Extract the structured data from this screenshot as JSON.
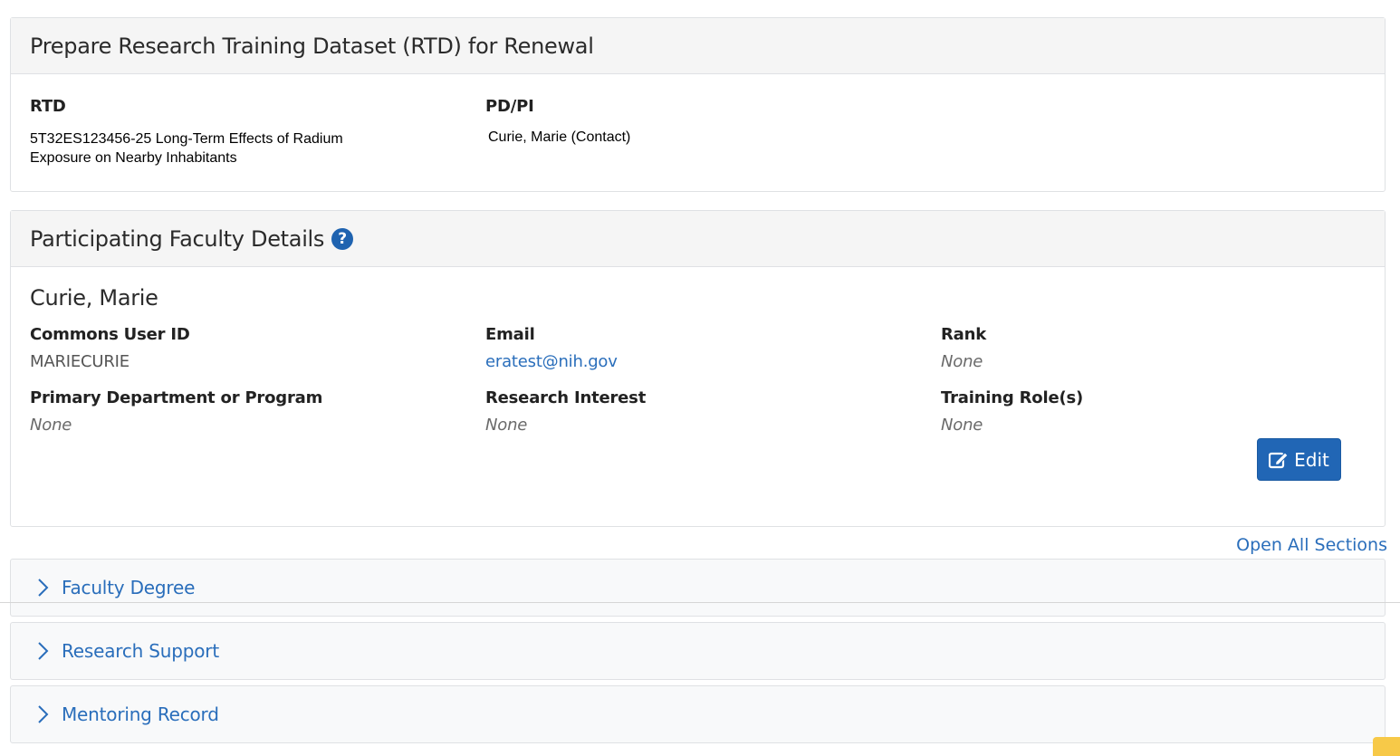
{
  "rtd_panel": {
    "title": "Prepare Research Training Dataset (RTD) for Renewal",
    "rtd_label": "RTD",
    "rtd_value_line1": "5T32ES123456-25 Long-Term Effects of Radium",
    "rtd_value_line2": "Exposure on Nearby Inhabitants",
    "pdpi_label": "PD/PI",
    "pdpi_value": "Curie, Marie (Contact)"
  },
  "faculty_panel": {
    "title": "Participating Faculty Details",
    "help_icon": "question-circle-icon",
    "name": "Curie, Marie",
    "fields": {
      "commons_label": "Commons User ID",
      "commons_value": "MARIECURIE",
      "email_label": "Email",
      "email_value": "eratest@nih.gov",
      "rank_label": "Rank",
      "rank_value": "None",
      "dept_label": "Primary Department or Program",
      "dept_value": "None",
      "interest_label": "Research Interest",
      "interest_value": "None",
      "roles_label": "Training Role(s)",
      "roles_value": "None"
    },
    "edit_label": "Edit",
    "edit_icon": "edit-icon"
  },
  "open_all_label": "Open All Sections",
  "sections": [
    {
      "label": "Faculty Degree",
      "icon": "chevron-right-icon"
    },
    {
      "label": "Research Support",
      "icon": "chevron-right-icon"
    },
    {
      "label": "Mentoring Record",
      "icon": "chevron-right-icon"
    }
  ],
  "colors": {
    "accent": "#2166b5",
    "link": "#2a6ebb",
    "panel_header": "#f5f5f5"
  }
}
